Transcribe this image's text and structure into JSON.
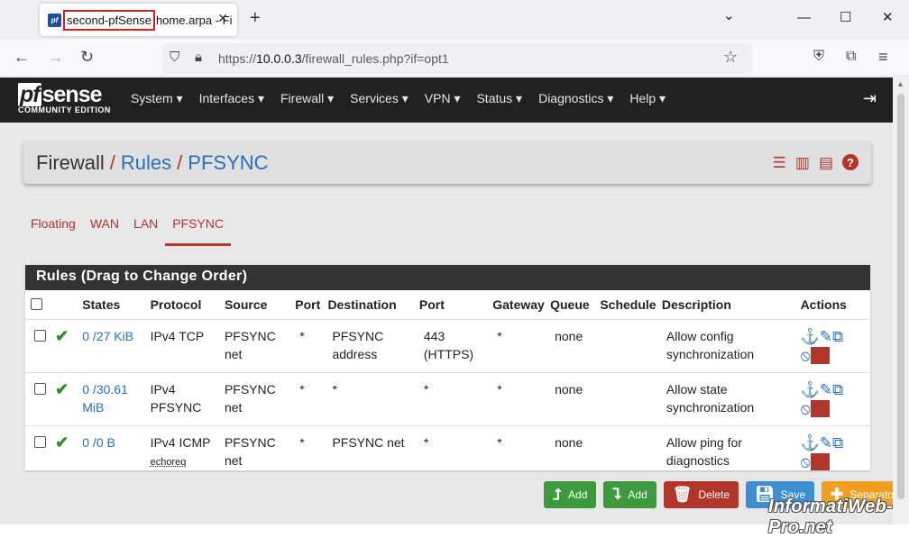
{
  "browser": {
    "tab": {
      "title_highlight": "second-pfSense",
      "title_rest": "home.arpa - Fi",
      "close": "✕"
    },
    "new_tab": "+",
    "window": {
      "collapse": "⌄",
      "minimize": "—",
      "maximize": "☐",
      "close": "✕"
    },
    "url": {
      "scheme": "https://",
      "host": "10.0.0.3",
      "path": "/firewall_rules.php?if=opt1"
    }
  },
  "header": {
    "logo_main": "sense",
    "logo_pf": "pf",
    "logo_sub": "COMMUNITY EDITION",
    "menu": [
      "System ▾",
      "Interfaces ▾",
      "Firewall ▾",
      "Services ▾",
      "VPN ▾",
      "Status ▾",
      "Diagnostics ▾",
      "Help ▾"
    ]
  },
  "breadcrumb": {
    "root": "Firewall",
    "rules": "Rules",
    "current": "PFSYNC",
    "sep": "/"
  },
  "tabs": [
    "Floating",
    "WAN",
    "LAN",
    "PFSYNC"
  ],
  "panel": {
    "title": "Rules (Drag to Change Order)"
  },
  "table": {
    "headers": [
      "States",
      "Protocol",
      "Source",
      "Port",
      "Destination",
      "Port",
      "Gateway",
      "Queue",
      "Schedule",
      "Description",
      "Actions"
    ],
    "rows": [
      {
        "states": "0 /27 KiB",
        "protocol": "IPv4 TCP",
        "protocol_sub": "",
        "source": "PFSYNC net",
        "port": "*",
        "destination": "PFSYNC address",
        "dport": "443 (HTTPS)",
        "gateway": "*",
        "queue": "none",
        "schedule": "",
        "description": "Allow config synchronization"
      },
      {
        "states": "0 /30.61 MiB",
        "protocol": "IPv4 PFSYNC",
        "protocol_sub": "",
        "source": "PFSYNC net",
        "port": "*",
        "destination": "*",
        "dport": "*",
        "gateway": "*",
        "queue": "none",
        "schedule": "",
        "description": "Allow state synchronization"
      },
      {
        "states": "0 /0 B",
        "protocol": "IPv4 ICMP",
        "protocol_sub": "echoreq",
        "source": "PFSYNC net",
        "port": "*",
        "destination": "PFSYNC net",
        "dport": "*",
        "gateway": "*",
        "queue": "none",
        "schedule": "",
        "description": "Allow ping for diagnostics"
      }
    ]
  },
  "buttons": {
    "add_top": "Add",
    "add_bottom": "Add",
    "delete": "Delete",
    "save": "Save",
    "separator": "Separator"
  },
  "watermark": "InformatiWeb-Pro.net",
  "colors": {
    "brand_red": "#b0362b",
    "link_blue": "#2b6fb6",
    "header_bg": "#212121"
  }
}
